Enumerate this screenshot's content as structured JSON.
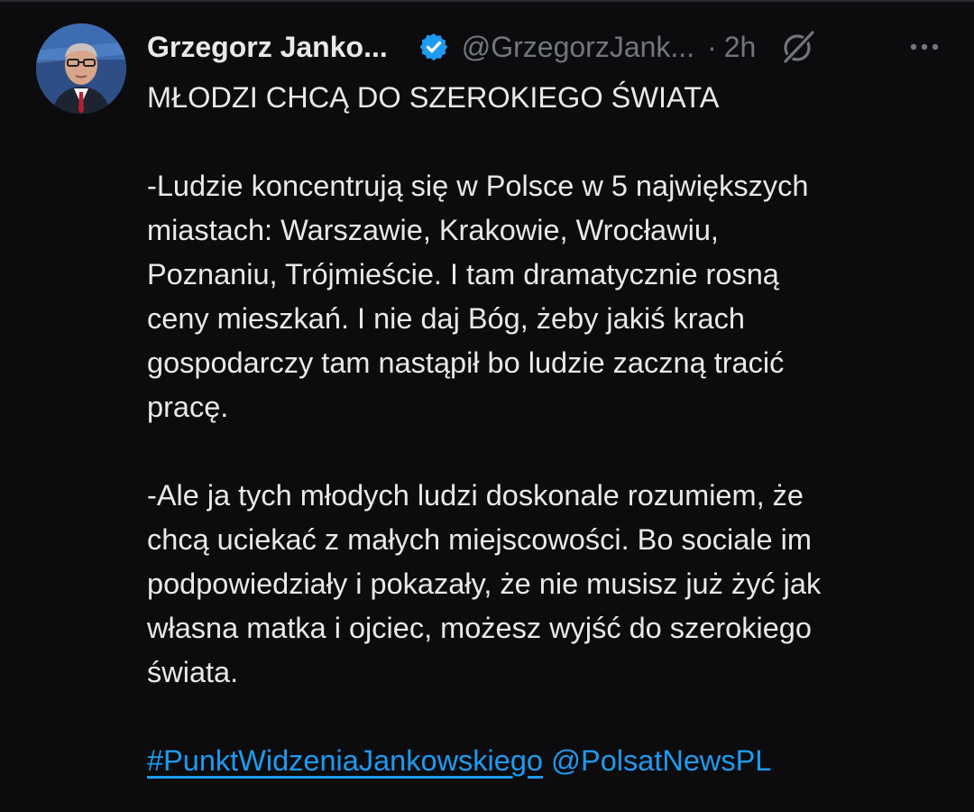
{
  "tweet": {
    "author_name": "Grzegorz Janko...",
    "handle": "@GrzegorzJank...",
    "separator": "·",
    "time": "2h",
    "title_line": "MŁODZI CHCĄ DO SZEROKIEGO ŚWIATA",
    "paragraph1_lines": [
      "-Ludzie koncentrują się w Polsce w 5 największych",
      "miastach: Warszawie, Krakowie, Wrocławiu,",
      "Poznaniu, Trójmieście. I tam dramatycznie rosną",
      "ceny mieszkań. I nie daj Bóg, żeby jakiś krach",
      "gospodarczy tam nastąpił bo ludzie zaczną tracić",
      "pracę."
    ],
    "paragraph2_lines": [
      "-Ale ja tych młodych ludzi doskonale rozumiem, że",
      "chcą uciekać z małych miejscowości. Bo sociale im",
      "podpowiedziały i pokazały, że nie musisz już żyć jak",
      "własna matka i ojciec, możesz wyjść do szerokiego",
      "świata."
    ],
    "hashtag": "#PunktWidzeniaJankowskiego",
    "mention": "@PolsatNewsPL"
  },
  "icons": {
    "verified": "verified-badge-icon",
    "grok": "grok-icon",
    "more": "more-options-icon"
  },
  "colors": {
    "background": "#0c0c0e",
    "text": "#e7e9ea",
    "secondary": "#71767b",
    "accent": "#1d9bf0"
  }
}
